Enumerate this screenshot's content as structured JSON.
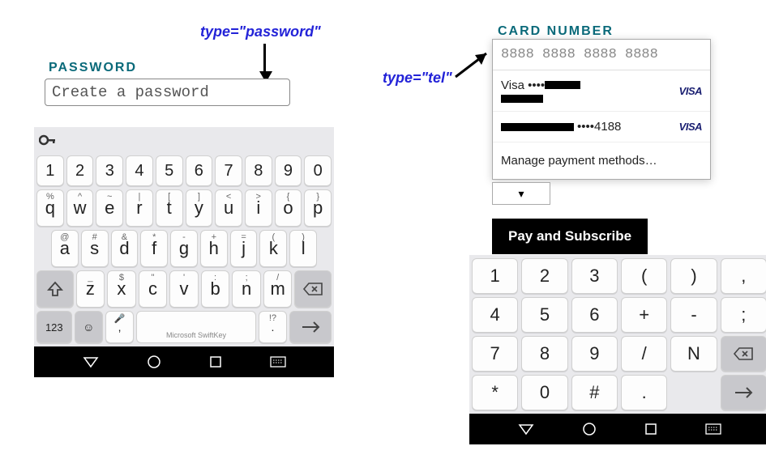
{
  "annotations": {
    "password": "type=\"password\"",
    "tel": "type=\"tel\""
  },
  "left": {
    "label": "PASSWORD",
    "placeholder": "Create a password",
    "keyboard": {
      "nums": [
        "1",
        "2",
        "3",
        "4",
        "5",
        "6",
        "7",
        "8",
        "9",
        "0"
      ],
      "row1": [
        {
          "k": "q",
          "s": "%"
        },
        {
          "k": "w",
          "s": "^"
        },
        {
          "k": "e",
          "s": "~"
        },
        {
          "k": "r",
          "s": "|"
        },
        {
          "k": "t",
          "s": "["
        },
        {
          "k": "y",
          "s": "]"
        },
        {
          "k": "u",
          "s": "<"
        },
        {
          "k": "i",
          "s": ">"
        },
        {
          "k": "o",
          "s": "{"
        },
        {
          "k": "p",
          "s": "}"
        }
      ],
      "row2": [
        {
          "k": "a",
          "s": "@"
        },
        {
          "k": "s",
          "s": "#"
        },
        {
          "k": "d",
          "s": "&"
        },
        {
          "k": "f",
          "s": "*"
        },
        {
          "k": "g",
          "s": "-"
        },
        {
          "k": "h",
          "s": "+"
        },
        {
          "k": "j",
          "s": "="
        },
        {
          "k": "k",
          "s": "("
        },
        {
          "k": "l",
          "s": ")"
        }
      ],
      "row3": [
        {
          "k": "z",
          "s": "_"
        },
        {
          "k": "x",
          "s": "$"
        },
        {
          "k": "c",
          "s": "\""
        },
        {
          "k": "v",
          "s": "'"
        },
        {
          "k": "b",
          "s": ":"
        },
        {
          "k": "n",
          "s": ";"
        },
        {
          "k": "m",
          "s": "/"
        }
      ],
      "bottom": {
        "sym": "123",
        "comma": ",",
        "space": "Microsoft SwiftKey",
        "period": ".",
        "period_sup": "!?"
      }
    }
  },
  "right": {
    "label": "CARD NUMBER",
    "placeholder": "8888 8888 8888 8888",
    "cards": [
      {
        "line1_prefix": "Visa ••••",
        "brand": "VISA"
      },
      {
        "line2_suffix": "••••4188",
        "brand": "VISA"
      }
    ],
    "manage": "Manage payment methods…",
    "select_caret": "▾",
    "pay_button": "Pay and Subscribe",
    "keypad": {
      "r1": [
        "1",
        "2",
        "3",
        "(",
        ")",
        ","
      ],
      "r2": [
        "4",
        "5",
        "6",
        "+",
        "-",
        ";"
      ],
      "r3": [
        "7",
        "8",
        "9",
        "/",
        "N"
      ],
      "r4": [
        "*",
        "0",
        "#",
        "."
      ]
    }
  }
}
